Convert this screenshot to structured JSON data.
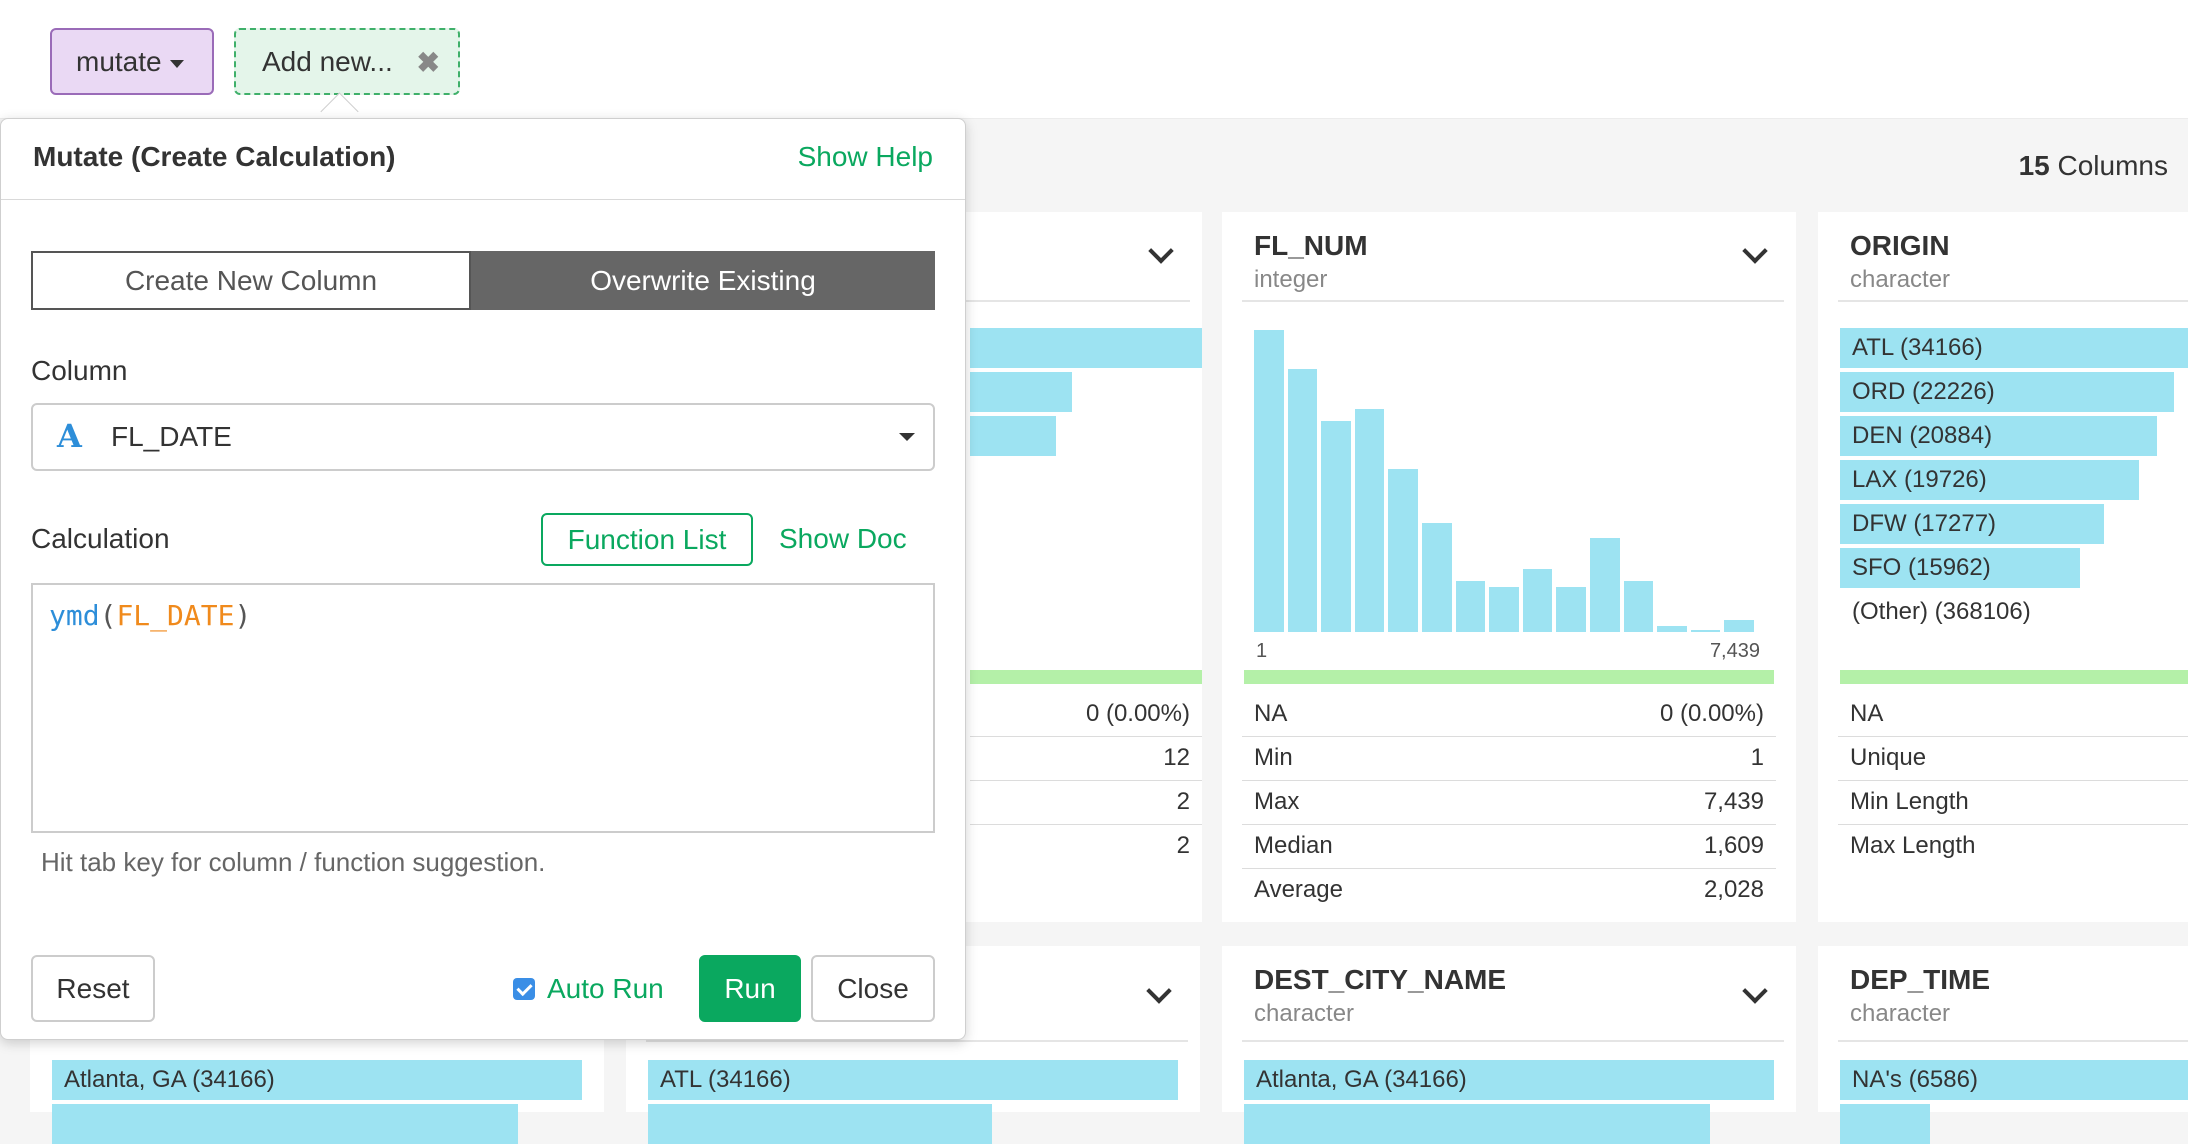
{
  "toolbar": {
    "mutate_label": "mutate",
    "addnew_label": "Add new..."
  },
  "summary": {
    "columns_count": "15",
    "columns_label": "Columns"
  },
  "popup": {
    "title": "Mutate (Create Calculation)",
    "show_help": "Show Help",
    "seg_create": "Create New Column",
    "seg_overwrite": "Overwrite Existing",
    "column_label": "Column",
    "column_type_icon": "A",
    "column_value": "FL_DATE",
    "calc_label": "Calculation",
    "function_list": "Function List",
    "show_doc": "Show Doc",
    "code_fn": "ymd",
    "code_open": "(",
    "code_col": "FL_DATE",
    "code_close": ")",
    "hint": "Hit tab key for column / function suggestion.",
    "reset": "Reset",
    "auto_run": "Auto Run",
    "run": "Run",
    "close": "Close"
  },
  "card_partial": {
    "stats": [
      {
        "value": "0 (0.00%)"
      },
      {
        "value": "12"
      },
      {
        "value": "2"
      },
      {
        "value": "2"
      }
    ],
    "bar_levels": [
      1.0,
      0.44,
      0.37
    ]
  },
  "card_fl_num": {
    "title": "FL_NUM",
    "type": "integer",
    "hist_levels": [
      1.0,
      0.87,
      0.7,
      0.74,
      0.54,
      0.36,
      0.17,
      0.15,
      0.21,
      0.15,
      0.31,
      0.17,
      0.02,
      0.005,
      0.04
    ],
    "axis_min": "1",
    "axis_max": "7,439",
    "stats": [
      {
        "key": "NA",
        "value": "0 (0.00%)"
      },
      {
        "key": "Min",
        "value": "1"
      },
      {
        "key": "Max",
        "value": "7,439"
      },
      {
        "key": "Median",
        "value": "1,609"
      },
      {
        "key": "Average",
        "value": "2,028"
      }
    ]
  },
  "card_origin": {
    "title": "ORIGIN",
    "type": "character",
    "bars": [
      {
        "label": "ATL (34166)",
        "level": 1.0
      },
      {
        "label": "ORD (22226)",
        "level": 0.96
      },
      {
        "label": "DEN (20884)",
        "level": 0.91
      },
      {
        "label": "LAX (19726)",
        "level": 0.86
      },
      {
        "label": "DFW (17277)",
        "level": 0.76
      },
      {
        "label": "SFO (15962)",
        "level": 0.69
      }
    ],
    "other": "(Other) (368106)",
    "stats": [
      {
        "key": "NA"
      },
      {
        "key": "Unique"
      },
      {
        "key": "Min Length"
      },
      {
        "key": "Max Length"
      }
    ]
  },
  "card_bottom_a": {
    "bar_label": "Atlanta, GA (34166)"
  },
  "card_bottom_b": {
    "bar_label": "ATL (34166)"
  },
  "card_dest_city": {
    "title": "DEST_CITY_NAME",
    "type": "character",
    "bar_label": "Atlanta, GA (34166)"
  },
  "card_dep_time": {
    "title": "DEP_TIME",
    "type": "character",
    "bar_label": "NA's (6586)"
  },
  "colors": {
    "accent_green": "#0aa85f",
    "bar_cyan": "#9de3f2",
    "mutate_purple": "#ead9f4"
  }
}
